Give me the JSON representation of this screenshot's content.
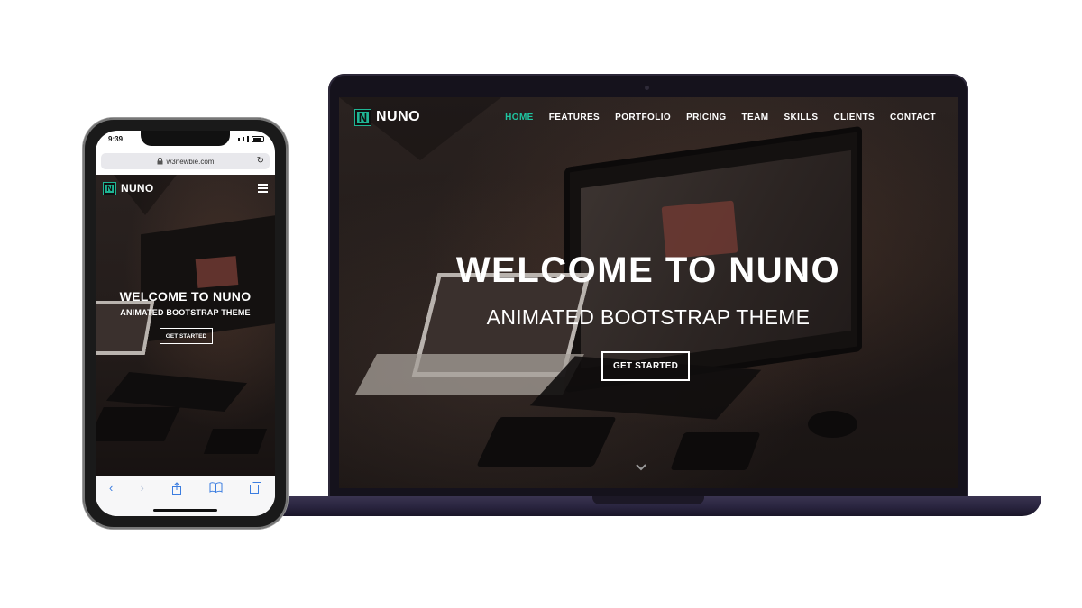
{
  "colors": {
    "accent": "#1fc6a1",
    "brand_mark": "#1fb594",
    "laptop_frame": "#2a2540",
    "hero_text": "#ffffff",
    "ios_link": "#3b7de0"
  },
  "site": {
    "brand_letter": "N",
    "brand_name": "NUNO",
    "nav": [
      "HOME",
      "FEATURES",
      "PORTFOLIO",
      "PRICING",
      "TEAM",
      "SKILLS",
      "CLIENTS",
      "CONTACT"
    ],
    "active_nav": "HOME",
    "hero_title": "WELCOME TO NUNO",
    "hero_subtitle": "ANIMATED BOOTSTRAP THEME",
    "cta_label": "GET STARTED",
    "scroll_icon": "chevron-down-icon"
  },
  "phone": {
    "time": "9:39",
    "url": "w3newbie.com",
    "menu_icon": "hamburger-icon",
    "toolbar_icons": [
      "back-icon",
      "forward-icon",
      "share-icon",
      "bookmarks-icon",
      "tabs-icon"
    ]
  }
}
